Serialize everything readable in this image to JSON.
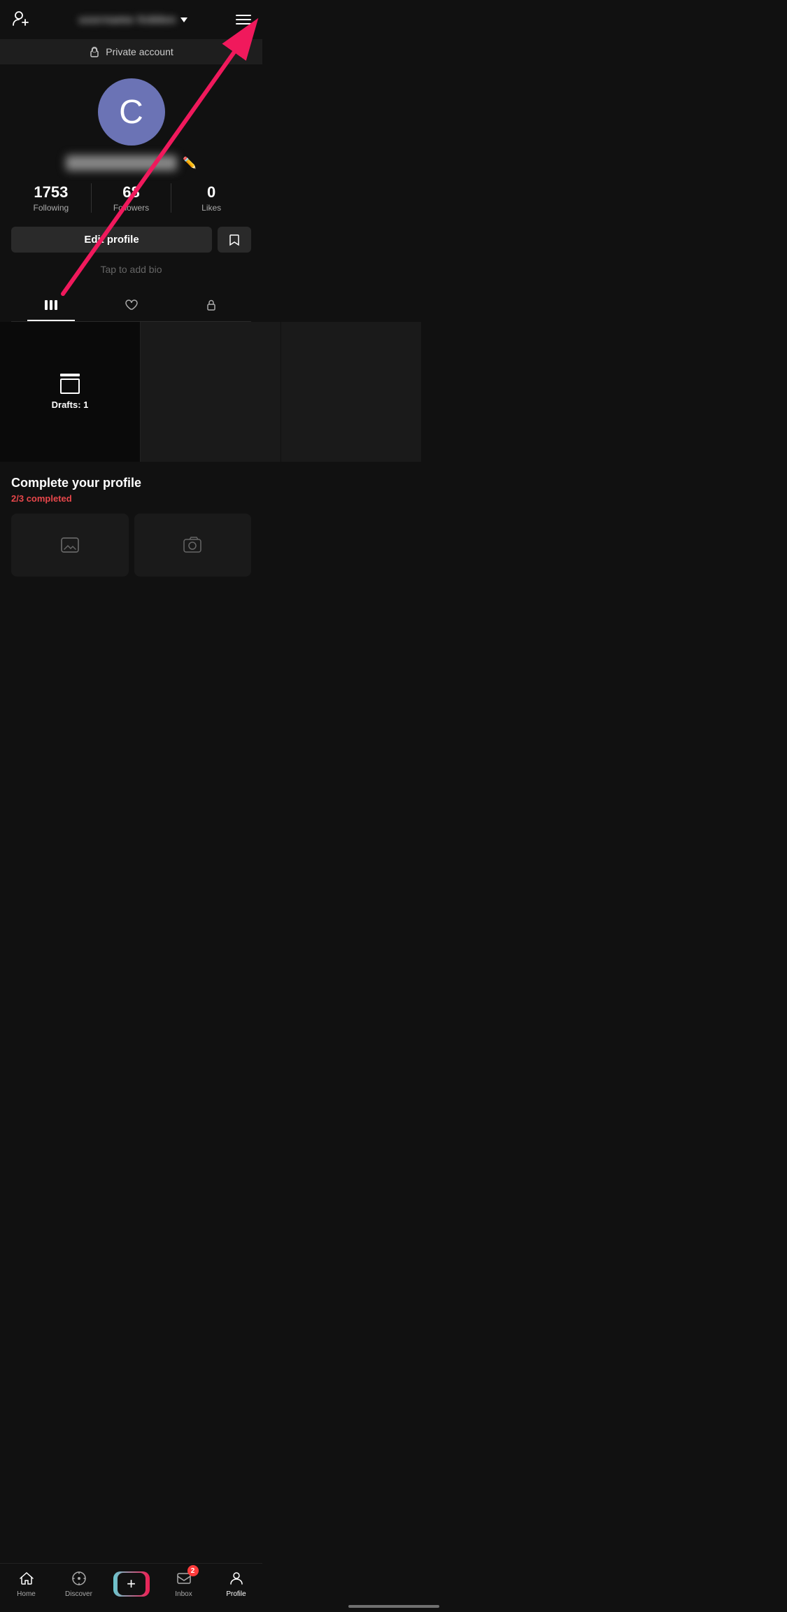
{
  "header": {
    "username": "username hidden",
    "add_friend_label": "Add Friend",
    "menu_label": "Menu"
  },
  "private_banner": {
    "text": "Private account",
    "icon": "lock-icon"
  },
  "profile": {
    "avatar_letter": "C",
    "username": "username hidden",
    "stats": {
      "following": {
        "value": "1753",
        "label": "Following"
      },
      "followers": {
        "value": "68",
        "label": "Followers"
      },
      "likes": {
        "value": "0",
        "label": "Likes"
      }
    },
    "edit_profile_label": "Edit profile",
    "bio_placeholder": "Tap to add bio"
  },
  "tabs": [
    {
      "id": "videos",
      "label": "Videos",
      "active": true
    },
    {
      "id": "liked",
      "label": "Liked"
    },
    {
      "id": "private",
      "label": "Private"
    }
  ],
  "drafts": {
    "label": "Drafts: 1"
  },
  "complete_profile": {
    "title": "Complete your profile",
    "progress": "2/3",
    "progress_label": "completed"
  },
  "nav": {
    "home": "Home",
    "discover": "Discover",
    "inbox": "Inbox",
    "inbox_badge": "2",
    "profile": "Profile",
    "create": "+"
  }
}
